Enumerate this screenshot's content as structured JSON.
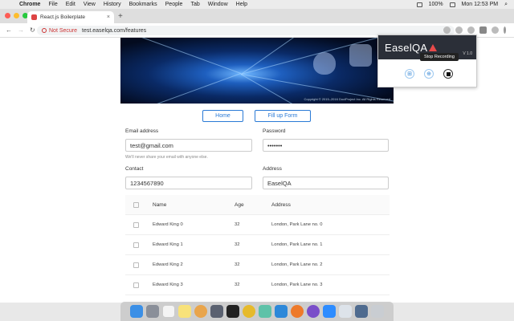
{
  "menubar": {
    "app": "Chrome",
    "items": [
      "File",
      "Edit",
      "View",
      "History",
      "Bookmarks",
      "People",
      "Tab",
      "Window",
      "Help"
    ],
    "battery": "100%",
    "clock": "Mon 12:53 PM"
  },
  "browser": {
    "tab_title": "React.js Boilerplate",
    "security": "Not Secure",
    "url": "test.easelqa.com/features"
  },
  "banner": {
    "copyright": "Copyright © 2015–2016 DoclProject Inc. All Rights Reserved"
  },
  "buttons": {
    "home": "Home",
    "fill_form": "Fill up Form"
  },
  "form": {
    "email_label": "Email address",
    "email_value": "test@gmail.com",
    "email_hint": "We'll never share your email with anyone else.",
    "password_label": "Password",
    "password_value": "•••••••",
    "contact_label": "Contact",
    "contact_value": "1234567890",
    "address_label": "Address",
    "address_value": "EaselQA"
  },
  "table": {
    "headers": [
      "Name",
      "Age",
      "Address"
    ],
    "rows": [
      {
        "name": "Edward King 0",
        "age": "32",
        "address": "London, Park Lane no. 0"
      },
      {
        "name": "Edward King 1",
        "age": "32",
        "address": "London, Park Lane no. 1"
      },
      {
        "name": "Edward King 2",
        "age": "32",
        "address": "London, Park Lane no. 2"
      },
      {
        "name": "Edward King 3",
        "age": "32",
        "address": "London, Park Lane no. 3"
      }
    ]
  },
  "popup": {
    "title": "EaselQA",
    "version": "V 1.0",
    "tooltip": "Stop Recording"
  },
  "colors": {
    "accent": "#2a7ad6",
    "warning": "#cc3333",
    "popup_header": "#2b2f38"
  }
}
